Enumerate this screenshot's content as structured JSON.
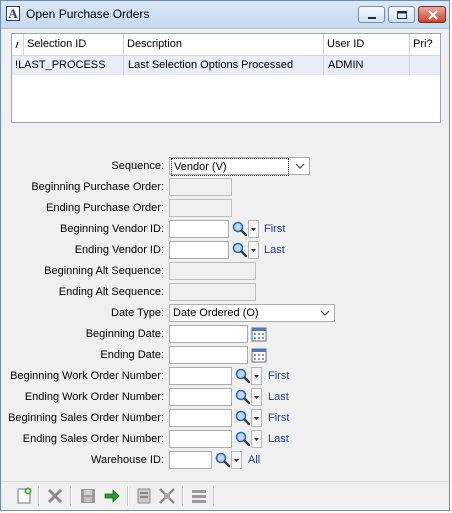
{
  "window": {
    "title": "Open Purchase Orders",
    "app_icon_letter": "A"
  },
  "grid": {
    "columns": [
      "Selection ID",
      "Description",
      "User ID",
      "Pri?"
    ],
    "rows": [
      {
        "indicator": "!",
        "selection_id": "LAST_PROCESS",
        "description": "Last Selection Options Processed",
        "user_id": "ADMIN",
        "pri": ""
      }
    ]
  },
  "form": {
    "sequence": {
      "label": "Sequence:",
      "value": "Vendor (V)"
    },
    "beg_po": {
      "label": "Beginning Purchase Order:",
      "value": ""
    },
    "end_po": {
      "label": "Ending Purchase Order:",
      "value": ""
    },
    "beg_vendor": {
      "label": "Beginning Vendor ID:",
      "value": "",
      "link": "First"
    },
    "end_vendor": {
      "label": "Ending Vendor ID:",
      "value": "",
      "link": "Last"
    },
    "beg_alt": {
      "label": "Beginning Alt Sequence:",
      "value": ""
    },
    "end_alt": {
      "label": "Ending Alt Sequence:",
      "value": ""
    },
    "date_type": {
      "label": "Date Type:",
      "value": "Date Ordered (O)"
    },
    "beg_date": {
      "label": "Beginning Date:",
      "value": ""
    },
    "end_date": {
      "label": "Ending Date:",
      "value": ""
    },
    "beg_wo": {
      "label": "Beginning Work Order Number:",
      "value": "",
      "link": "First"
    },
    "end_wo": {
      "label": "Ending Work Order Number:",
      "value": "",
      "link": "Last"
    },
    "beg_so": {
      "label": "Beginning Sales Order Number:",
      "value": "",
      "link": "First"
    },
    "end_so": {
      "label": "Ending Sales Order Number:",
      "value": "",
      "link": "Last"
    },
    "warehouse": {
      "label": "Warehouse ID:",
      "value": "",
      "link": "All"
    }
  },
  "colors": {
    "link": "#1a3f9c",
    "selected_row": "#e7eef7",
    "titlebar": "#c6d9ee"
  }
}
